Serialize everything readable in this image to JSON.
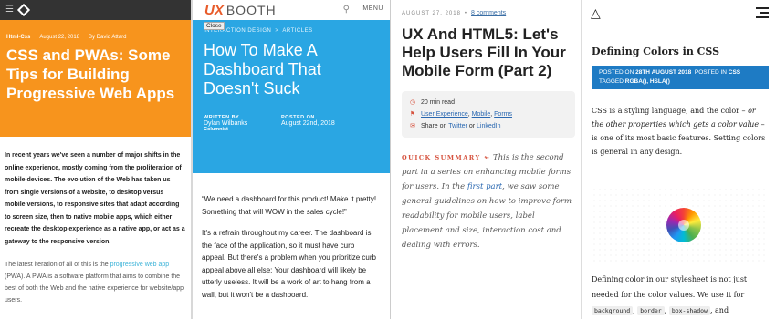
{
  "panel1": {
    "category": "Html-Css",
    "date": "August 22, 2018",
    "author": "By David Attard",
    "title": "CSS and PWAs: Some Tips for Building Progressive Web Apps",
    "para1": "In recent years we've seen a number of major shifts in the online experience, mostly coming from the proliferation of mobile devices. The evolution of the Web has taken us from single versions of a website, to desktop versus mobile versions, to responsive sites that adapt according to screen size, then to native mobile apps, which either recreate the desktop experience as a native app, or act as a gateway to the responsive version.",
    "para2_before": "The latest iteration of all of this is the ",
    "para2_link": "progressive web app",
    "para2_after": " (PWA). A PWA is a software platform that aims to combine the best of both the Web and the native experience for website/app users.",
    "colors": {
      "hero": "#f7941d",
      "topbar": "#333333",
      "link": "#3bb3d8"
    }
  },
  "panel2": {
    "brand_ux": "UX",
    "brand_booth": "BOOTH",
    "menu": "MENU",
    "close": "Close",
    "crumb1": "INTERACTION DESIGN",
    "crumb_sep": ">",
    "crumb2": "ARTICLES",
    "title": "How To Make A Dashboard That Doesn't Suck",
    "written_by_label": "WRITTEN BY",
    "author": "Dylan Wilbanks",
    "author_role": "Columnist",
    "posted_on_label": "POSTED ON",
    "date": "August 22nd, 2018",
    "body1": "“We need a dashboard for this product! Make it pretty! Something that will WOW in the sales cycle!”",
    "body2": "It's a refrain throughout my career. The dashboard is the face of the application, so it must have curb appeal. But there's a problem when you prioritize curb appeal above all else: Your dashboard will likely be utterly useless. It will be a work of art to hang from a wall, but it won't be a dashboard.",
    "colors": {
      "hero": "#2aa6e3",
      "brand": "#e85b2a"
    }
  },
  "panel3": {
    "date": "AUGUST 27, 2018",
    "sep": "•",
    "comments": "8 comments",
    "title": "UX And HTML5: Let's Help Users Fill In Your Mobile Form (Part 2)",
    "read_time": "20 min read",
    "tag1": "User Experience",
    "tag2": "Mobile",
    "tag3": "Forms",
    "share_text": "Share on",
    "share1": "Twitter",
    "share_or": "or",
    "share2": "LinkedIn",
    "summary_label": "QUICK SUMMARY ↬",
    "summary_before": " This is the second part in a series on enhancing mobile forms for users. In the ",
    "summary_link": "first part",
    "summary_after": ", we saw some general guidelines on how to improve form readability for mobile users, label placement and size, interaction cost and dealing with errors.",
    "colors": {
      "accent": "#d6523e",
      "link": "#2a68b1"
    }
  },
  "panel4": {
    "title": "Defining Colors in CSS",
    "posted_on": "POSTED ON",
    "date": "28TH AUGUST 2018",
    "posted_in": "POSTED IN",
    "category": "CSS",
    "tagged": "TAGGED",
    "tags": "RGBA(), HSLA()",
    "para1_a": "CSS is a styling language, and the color – ",
    "para1_em": "or the other properties which gets a color value",
    "para1_b": " – is one of its most basic features. Setting colors is general in any design.",
    "para2": "Defining color in our stylesheet is not just needed for the color values. We use it for",
    "code1": "background",
    "code2": "border",
    "code3": "box-shadow",
    "para2_end": ", and",
    "colors": {
      "metabox": "#1e7bc4"
    }
  }
}
